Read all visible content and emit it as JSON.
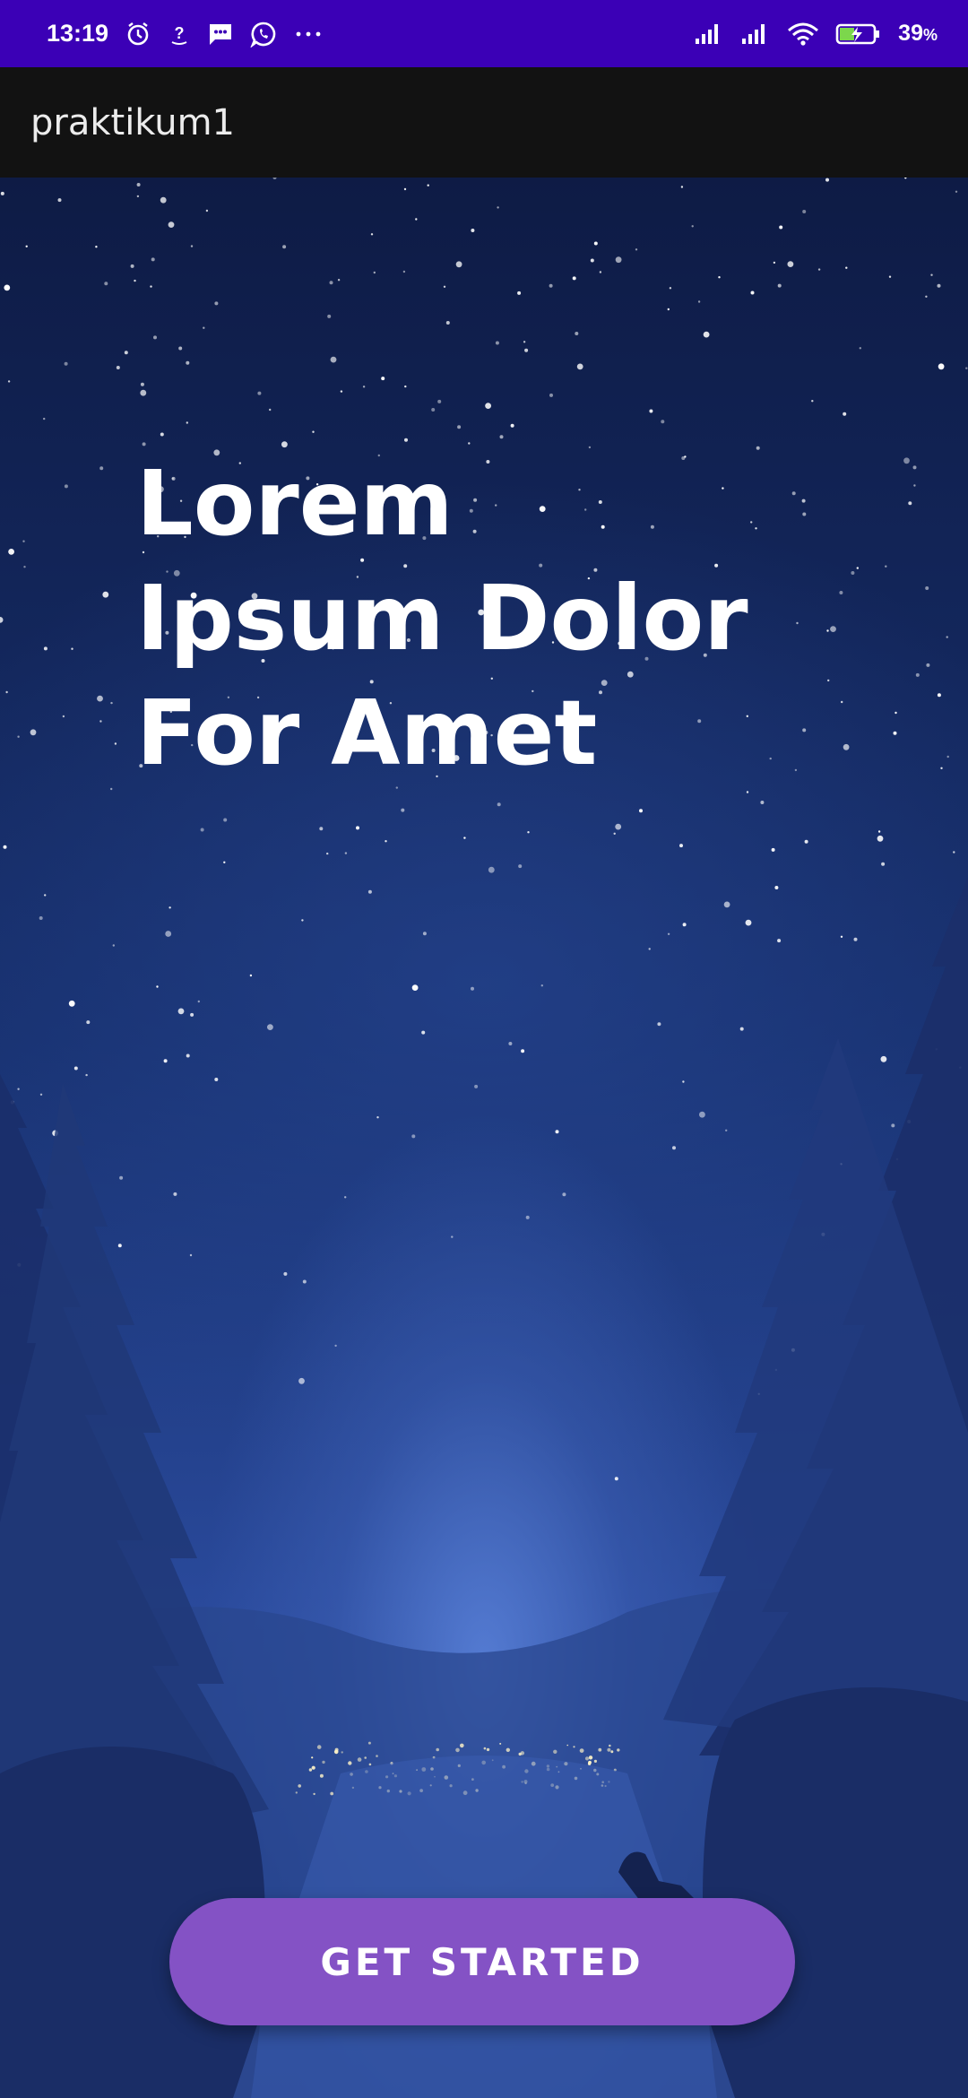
{
  "status_bar": {
    "time": "13:19",
    "battery_percent": "39",
    "battery_suffix": "%",
    "icons_left": [
      "alarm-icon",
      "help-signal-icon",
      "message-icon",
      "whatsapp-icon",
      "more-dots-icon"
    ],
    "icons_right": [
      "signal-icon",
      "signal-icon",
      "wifi-icon",
      "battery-charging-icon"
    ]
  },
  "app_bar": {
    "title": "praktikum1"
  },
  "hero": {
    "lines": [
      "Lorem",
      "Ipsum Dolor",
      "For Amet"
    ]
  },
  "cta": {
    "label": "GET STARTED"
  },
  "colors": {
    "status_bar": "#3b00b6",
    "app_bar": "#121212",
    "button": "#8452c5"
  }
}
